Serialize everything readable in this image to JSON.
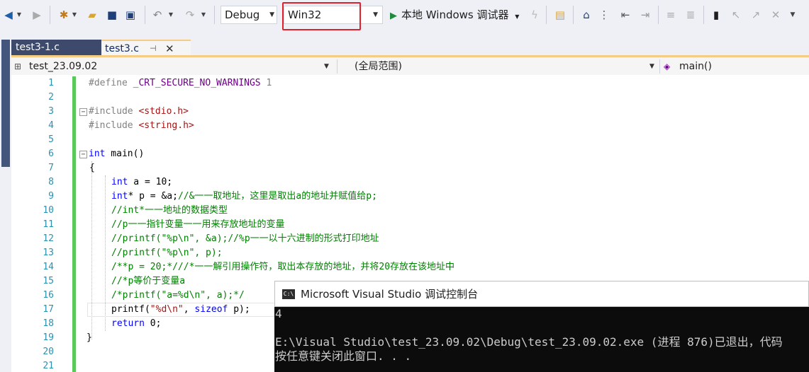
{
  "toolbar": {
    "config": "Debug",
    "platform": "Win32",
    "run_label": "本地 Windows 调试器",
    "icons": [
      "back-icon",
      "forward-icon",
      "new-project-icon",
      "open-icon",
      "save-icon",
      "save-all-icon",
      "undo-icon",
      "redo-icon",
      "play-icon",
      "hot-reload-icon",
      "folder-icon",
      "home-icon",
      "bookmark-icon"
    ]
  },
  "tabs": [
    {
      "label": "test3-1.c",
      "active": false
    },
    {
      "label": "test3.c",
      "active": true
    }
  ],
  "navbar": {
    "project": "test_23.09.02",
    "scope": "(全局范围)",
    "member": "main()"
  },
  "editor": {
    "line_numbers": [
      "1",
      "2",
      "3",
      "4",
      "5",
      "6",
      "7",
      "8",
      "9",
      "10",
      "11",
      "12",
      "13",
      "14",
      "15",
      "16",
      "17",
      "18",
      "19",
      "20",
      "21"
    ],
    "lines": {
      "l1a": "#define ",
      "l1b": "_CRT_SECURE_NO_WARNINGS",
      "l1c": " 1",
      "l3a": "#include ",
      "l3b": "<stdio.h>",
      "l4a": "#include ",
      "l4b": "<string.h>",
      "l6a": "int",
      "l6b": " main()",
      "l7": "{",
      "l8a": "int",
      "l8b": " a = 10;",
      "l9a": "int",
      "l9b": "* p = &a;",
      "l9c": "//&一一取地址，这里是取出a的地址并赋值给p;",
      "l10": "//int*一一地址的数据类型",
      "l11": "//p一一指针变量一一用来存放地址的变量",
      "l12": "//printf(\"%p\\n\", &a);//%p一一以十六进制的形式打印地址",
      "l13": "//printf(\"%p\\n\", p);",
      "l14": "/**p = 20;*///*一一解引用操作符，取出本存放的地址，并将20存放在该地址中",
      "l15": "//*p等价于变量a",
      "l16": "/*printf(\"a=%d\\n\", a);*/",
      "l17a": "printf(",
      "l17b": "\"%d\\n\"",
      "l17c": ", ",
      "l17d": "sizeof",
      "l17e": " p);",
      "l18a": "return",
      "l18b": " 0;",
      "l19": "}"
    }
  },
  "console": {
    "title": "Microsoft Visual Studio 调试控制台",
    "icon_text": "C:\\",
    "output_line1": "4",
    "output_line2": "E:\\Visual Studio\\test_23.09.02\\Debug\\test_23.09.02.exe (进程 876)已退出，代码",
    "output_line3": "按任意键关闭此窗口. . ."
  },
  "colors": {
    "highlight_border": "#e0202a",
    "active_tab_border": "#f5cc84",
    "change_bar": "#5ac85a"
  }
}
